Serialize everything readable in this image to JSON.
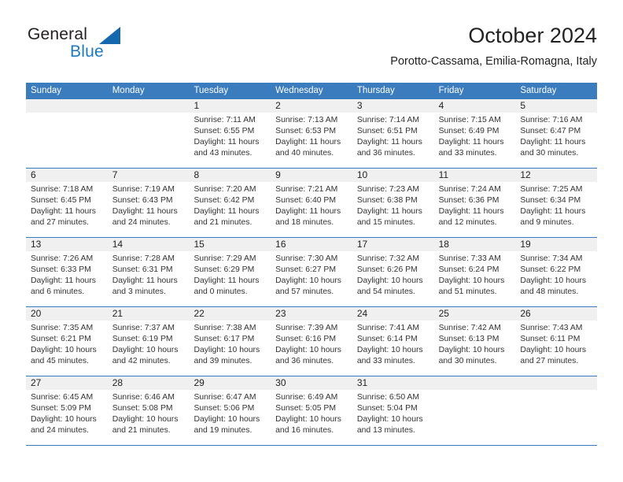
{
  "brand": {
    "name_top": "General",
    "name_bottom": "Blue"
  },
  "header": {
    "title": "October 2024",
    "subtitle": "Porotto-Cassama, Emilia-Romagna, Italy"
  },
  "colors": {
    "header_blue": "#3a7cbe",
    "brand_blue": "#1c7ac0",
    "date_strip_gray": "#f0f0f0"
  },
  "weekdays": [
    "Sunday",
    "Monday",
    "Tuesday",
    "Wednesday",
    "Thursday",
    "Friday",
    "Saturday"
  ],
  "labels": {
    "sunrise_prefix": "Sunrise:",
    "sunset_prefix": "Sunset:",
    "daylight_prefix": "Daylight:"
  },
  "weeks": [
    [
      {
        "day": "",
        "line1": "",
        "line2": "",
        "line3": "",
        "line4": ""
      },
      {
        "day": "",
        "line1": "",
        "line2": "",
        "line3": "",
        "line4": ""
      },
      {
        "day": "1",
        "line1": "Sunrise: 7:11 AM",
        "line2": "Sunset: 6:55 PM",
        "line3": "Daylight: 11 hours",
        "line4": "and 43 minutes."
      },
      {
        "day": "2",
        "line1": "Sunrise: 7:13 AM",
        "line2": "Sunset: 6:53 PM",
        "line3": "Daylight: 11 hours",
        "line4": "and 40 minutes."
      },
      {
        "day": "3",
        "line1": "Sunrise: 7:14 AM",
        "line2": "Sunset: 6:51 PM",
        "line3": "Daylight: 11 hours",
        "line4": "and 36 minutes."
      },
      {
        "day": "4",
        "line1": "Sunrise: 7:15 AM",
        "line2": "Sunset: 6:49 PM",
        "line3": "Daylight: 11 hours",
        "line4": "and 33 minutes."
      },
      {
        "day": "5",
        "line1": "Sunrise: 7:16 AM",
        "line2": "Sunset: 6:47 PM",
        "line3": "Daylight: 11 hours",
        "line4": "and 30 minutes."
      }
    ],
    [
      {
        "day": "6",
        "line1": "Sunrise: 7:18 AM",
        "line2": "Sunset: 6:45 PM",
        "line3": "Daylight: 11 hours",
        "line4": "and 27 minutes."
      },
      {
        "day": "7",
        "line1": "Sunrise: 7:19 AM",
        "line2": "Sunset: 6:43 PM",
        "line3": "Daylight: 11 hours",
        "line4": "and 24 minutes."
      },
      {
        "day": "8",
        "line1": "Sunrise: 7:20 AM",
        "line2": "Sunset: 6:42 PM",
        "line3": "Daylight: 11 hours",
        "line4": "and 21 minutes."
      },
      {
        "day": "9",
        "line1": "Sunrise: 7:21 AM",
        "line2": "Sunset: 6:40 PM",
        "line3": "Daylight: 11 hours",
        "line4": "and 18 minutes."
      },
      {
        "day": "10",
        "line1": "Sunrise: 7:23 AM",
        "line2": "Sunset: 6:38 PM",
        "line3": "Daylight: 11 hours",
        "line4": "and 15 minutes."
      },
      {
        "day": "11",
        "line1": "Sunrise: 7:24 AM",
        "line2": "Sunset: 6:36 PM",
        "line3": "Daylight: 11 hours",
        "line4": "and 12 minutes."
      },
      {
        "day": "12",
        "line1": "Sunrise: 7:25 AM",
        "line2": "Sunset: 6:34 PM",
        "line3": "Daylight: 11 hours",
        "line4": "and 9 minutes."
      }
    ],
    [
      {
        "day": "13",
        "line1": "Sunrise: 7:26 AM",
        "line2": "Sunset: 6:33 PM",
        "line3": "Daylight: 11 hours",
        "line4": "and 6 minutes."
      },
      {
        "day": "14",
        "line1": "Sunrise: 7:28 AM",
        "line2": "Sunset: 6:31 PM",
        "line3": "Daylight: 11 hours",
        "line4": "and 3 minutes."
      },
      {
        "day": "15",
        "line1": "Sunrise: 7:29 AM",
        "line2": "Sunset: 6:29 PM",
        "line3": "Daylight: 11 hours",
        "line4": "and 0 minutes."
      },
      {
        "day": "16",
        "line1": "Sunrise: 7:30 AM",
        "line2": "Sunset: 6:27 PM",
        "line3": "Daylight: 10 hours",
        "line4": "and 57 minutes."
      },
      {
        "day": "17",
        "line1": "Sunrise: 7:32 AM",
        "line2": "Sunset: 6:26 PM",
        "line3": "Daylight: 10 hours",
        "line4": "and 54 minutes."
      },
      {
        "day": "18",
        "line1": "Sunrise: 7:33 AM",
        "line2": "Sunset: 6:24 PM",
        "line3": "Daylight: 10 hours",
        "line4": "and 51 minutes."
      },
      {
        "day": "19",
        "line1": "Sunrise: 7:34 AM",
        "line2": "Sunset: 6:22 PM",
        "line3": "Daylight: 10 hours",
        "line4": "and 48 minutes."
      }
    ],
    [
      {
        "day": "20",
        "line1": "Sunrise: 7:35 AM",
        "line2": "Sunset: 6:21 PM",
        "line3": "Daylight: 10 hours",
        "line4": "and 45 minutes."
      },
      {
        "day": "21",
        "line1": "Sunrise: 7:37 AM",
        "line2": "Sunset: 6:19 PM",
        "line3": "Daylight: 10 hours",
        "line4": "and 42 minutes."
      },
      {
        "day": "22",
        "line1": "Sunrise: 7:38 AM",
        "line2": "Sunset: 6:17 PM",
        "line3": "Daylight: 10 hours",
        "line4": "and 39 minutes."
      },
      {
        "day": "23",
        "line1": "Sunrise: 7:39 AM",
        "line2": "Sunset: 6:16 PM",
        "line3": "Daylight: 10 hours",
        "line4": "and 36 minutes."
      },
      {
        "day": "24",
        "line1": "Sunrise: 7:41 AM",
        "line2": "Sunset: 6:14 PM",
        "line3": "Daylight: 10 hours",
        "line4": "and 33 minutes."
      },
      {
        "day": "25",
        "line1": "Sunrise: 7:42 AM",
        "line2": "Sunset: 6:13 PM",
        "line3": "Daylight: 10 hours",
        "line4": "and 30 minutes."
      },
      {
        "day": "26",
        "line1": "Sunrise: 7:43 AM",
        "line2": "Sunset: 6:11 PM",
        "line3": "Daylight: 10 hours",
        "line4": "and 27 minutes."
      }
    ],
    [
      {
        "day": "27",
        "line1": "Sunrise: 6:45 AM",
        "line2": "Sunset: 5:09 PM",
        "line3": "Daylight: 10 hours",
        "line4": "and 24 minutes."
      },
      {
        "day": "28",
        "line1": "Sunrise: 6:46 AM",
        "line2": "Sunset: 5:08 PM",
        "line3": "Daylight: 10 hours",
        "line4": "and 21 minutes."
      },
      {
        "day": "29",
        "line1": "Sunrise: 6:47 AM",
        "line2": "Sunset: 5:06 PM",
        "line3": "Daylight: 10 hours",
        "line4": "and 19 minutes."
      },
      {
        "day": "30",
        "line1": "Sunrise: 6:49 AM",
        "line2": "Sunset: 5:05 PM",
        "line3": "Daylight: 10 hours",
        "line4": "and 16 minutes."
      },
      {
        "day": "31",
        "line1": "Sunrise: 6:50 AM",
        "line2": "Sunset: 5:04 PM",
        "line3": "Daylight: 10 hours",
        "line4": "and 13 minutes."
      },
      {
        "day": "",
        "line1": "",
        "line2": "",
        "line3": "",
        "line4": ""
      },
      {
        "day": "",
        "line1": "",
        "line2": "",
        "line3": "",
        "line4": ""
      }
    ]
  ]
}
